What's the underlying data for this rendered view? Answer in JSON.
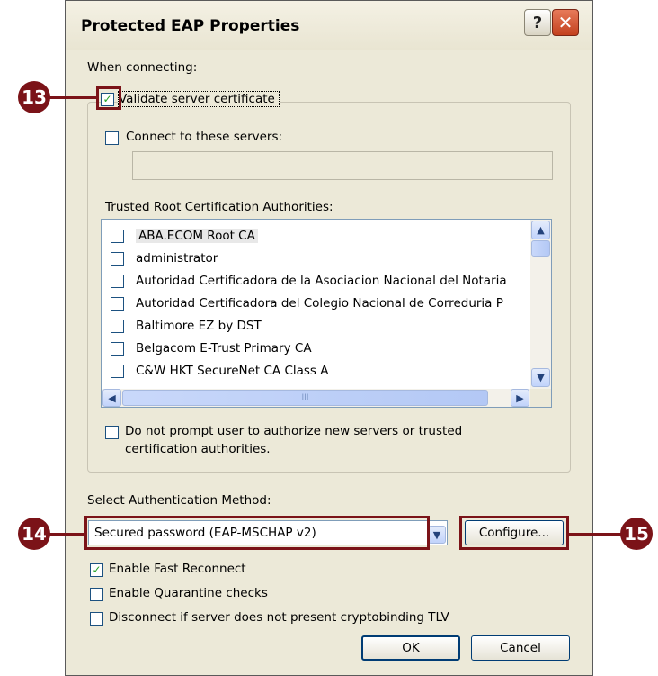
{
  "window": {
    "title": "Protected EAP Properties"
  },
  "titlebar": {
    "help_label": "?",
    "close_label": "✕"
  },
  "when_connecting_label": "When connecting:",
  "validate_cert": {
    "label": "Validate server certificate",
    "checked": true
  },
  "connect_servers": {
    "label": "Connect to these servers:",
    "checked": false,
    "value": ""
  },
  "trusted_root": {
    "label": "Trusted Root Certification Authorities:",
    "items": [
      {
        "label": "ABA.ECOM Root CA",
        "checked": false
      },
      {
        "label": "administrator",
        "checked": false
      },
      {
        "label": "Autoridad Certificadora de la Asociacion Nacional del Notaria",
        "checked": false
      },
      {
        "label": "Autoridad Certificadora del Colegio Nacional de Correduria P",
        "checked": false
      },
      {
        "label": "Baltimore EZ by DST",
        "checked": false
      },
      {
        "label": "Belgacom E-Trust Primary CA",
        "checked": false
      },
      {
        "label": "C&W HKT SecureNet CA Class A",
        "checked": false
      }
    ],
    "hscroll_grip": "III"
  },
  "no_prompt": {
    "label": "Do not prompt user to authorize new servers or trusted certification authorities.",
    "line1": "Do not prompt user to authorize new servers or trusted",
    "line2": "certification authorities.",
    "checked": false
  },
  "auth_method": {
    "label": "Select Authentication Method:",
    "selected": "Secured password (EAP-MSCHAP v2)",
    "configure_label": "Configure..."
  },
  "options": [
    {
      "label": "Enable Fast Reconnect",
      "checked": true
    },
    {
      "label": "Enable Quarantine checks",
      "checked": false
    },
    {
      "label": "Disconnect if server does not present cryptobinding TLV",
      "checked": false
    }
  ],
  "buttons": {
    "ok_label": "OK",
    "cancel_label": "Cancel"
  },
  "callouts": {
    "c13": "13",
    "c14": "14",
    "c15": "15"
  },
  "colors": {
    "callout": "#7b1318",
    "dialog_bg": "#ece9d8",
    "check_green": "#21a121"
  }
}
